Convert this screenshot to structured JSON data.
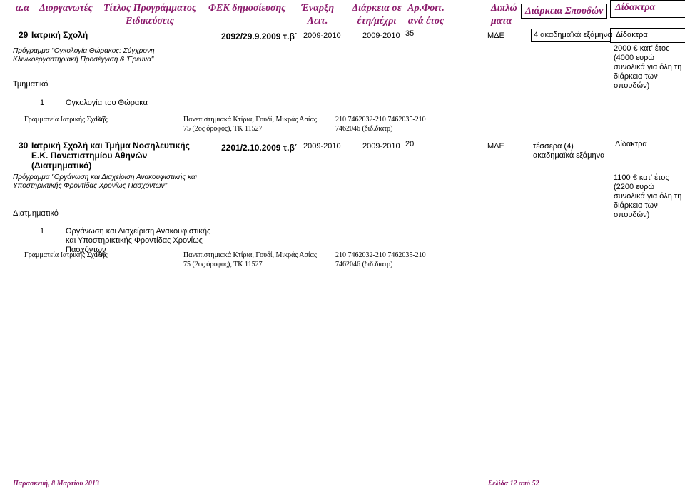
{
  "header": {
    "col_aa": "α.α",
    "col_org": "Διοργανωτές",
    "col_title_1": "Τίτλος Προγράμματος",
    "col_title_2": "Ειδικεύσεις",
    "col_fek": "ΦΕΚ δημοσίευσης",
    "col_start_1": "Έναρξη",
    "col_start_2": "Λειτ.",
    "col_duration_1": "Διάρκεια σε",
    "col_duration_2": "έτη/μέχρι",
    "col_students_1": "Αρ.Φοιτ.",
    "col_students_2": "ανά έτος",
    "col_degree_1": "Διπλώ",
    "col_degree_2": "ματα",
    "col_study_duration": "Διάρκεια Σπουδών",
    "col_fees": "Δίδακτρα"
  },
  "entries": [
    {
      "number": "29",
      "organizer": "Ιατρική Σχολή",
      "fek": "2092/29.9.2009 τ.β΄",
      "start": "2009-2010",
      "end": "2009-2010",
      "students": "35",
      "degree": "ΜΔΕ",
      "study_duration": "4 ακαδημαϊκά εξάμηνα",
      "fees_label": "Δίδακτρα",
      "fees_detail": "2000 € κατ' έτος (4000 ευρώ συνολικά για όλη τη διάρκεια των σπουδών)",
      "program": "Πρόγραμμα \"Ογκολογία Θώρακος: Σύγχρονη Κλινικοεργαστηριακή Προσέγγιση & Έρευνα\"",
      "dept_type": "Τμηματικό",
      "spec_number": "1",
      "spec_name": "Ογκολογία του Θώρακα",
      "secretariat": "Γραμματεία Ιατρικής Σχολής",
      "secretariat_overlap": "147",
      "address": "Πανεπιστημιακά Κτίρια, Γουδί, Μικράς Ασίας 75 (2ος όροφος), ΤΚ 11527",
      "phones": "210 7462032-210 7462035-210 7462046 (διδ.διατρ)"
    },
    {
      "number": "30",
      "organizer": "Ιατρική Σχολή και Τμήμα Νοσηλευτικής Ε.Κ. Πανεπιστημίου Αθηνών (Διατμηματικό)",
      "fek": "2201/2.10.2009 τ.β΄",
      "start": "2009-2010",
      "end": "2009-2010",
      "students": "20",
      "degree": "ΜΔΕ",
      "study_duration": "τέσσερα (4) ακαδημαϊκά εξάμηνα",
      "fees_label": "Δίδακτρα",
      "fees_detail": "1100 € κατ' έτος (2200 ευρώ συνολικά για όλη τη διάρκεια των σπουδών)",
      "program": "Πρόγραμμα \"Οργάνωση και Διαχείριση Ανακουφιστικής και Υποστηρικτικής Φροντίδας Χρονίως Πασχόντων\"",
      "dept_type": "Διατμηματικό",
      "spec_number": "1",
      "spec_name": "Οργάνωση και Διαχείριση Ανακουφιστικής και Υποστηρικτικής Φροντίδας Χρονίως Πασχόντων",
      "secretariat": "Γραμματεία Ιατρικής Σχολής",
      "secretariat_overlap": "156",
      "address": "Πανεπιστημιακά Κτίρια, Γουδί, Μικράς Ασίας 75 (2ος όροφος), ΤΚ 11527",
      "phones": "210 7462032-210 7462035-210 7462046 (διδ.διατρ)"
    }
  ],
  "footer": {
    "date": "Παρασκευή, 8 Μαρτίου 2013",
    "page": "Σελίδα 12 από 52"
  }
}
